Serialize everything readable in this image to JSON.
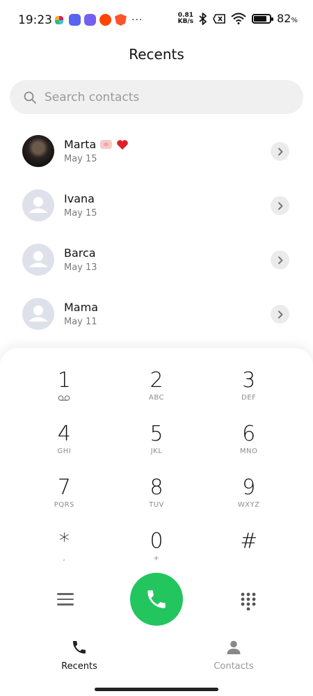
{
  "status_bar": {
    "time": "19:23",
    "net_speed_value": "0.81",
    "net_speed_unit": "KB/s",
    "battery_percent_number": "82",
    "battery_percent_sign": "%",
    "battery_level": 0.82,
    "more_glyph": "···",
    "app_icons": [
      "slack-icon",
      "discord-icon",
      "viber-icon",
      "reddit-icon",
      "brave-icon"
    ]
  },
  "header": {
    "title": "Recents"
  },
  "search": {
    "placeholder": "Search contacts"
  },
  "recents": [
    {
      "name": "Marta",
      "date": "May 15",
      "avatar": "photo",
      "emoji": [
        "pig-icon",
        "heart-icon"
      ]
    },
    {
      "name": "Ivana",
      "date": "May 15",
      "avatar": "default"
    },
    {
      "name": "Barca",
      "date": "May 13",
      "avatar": "default"
    },
    {
      "name": "Mama",
      "date": "May 11",
      "avatar": "default"
    }
  ],
  "dialpad": [
    {
      "digit": "1",
      "letters": ""
    },
    {
      "digit": "2",
      "letters": "ABC"
    },
    {
      "digit": "3",
      "letters": "DEF"
    },
    {
      "digit": "4",
      "letters": "GHI"
    },
    {
      "digit": "5",
      "letters": "JKL"
    },
    {
      "digit": "6",
      "letters": "MNO"
    },
    {
      "digit": "7",
      "letters": "PQRS"
    },
    {
      "digit": "8",
      "letters": "TUV"
    },
    {
      "digit": "9",
      "letters": "WXYZ"
    },
    {
      "digit": "*",
      "letters": ","
    },
    {
      "digit": "0",
      "letters": "+"
    },
    {
      "digit": "#",
      "letters": ""
    }
  ],
  "bottom_nav": {
    "recents_label": "Recents",
    "contacts_label": "Contacts"
  },
  "colors": {
    "call_button": "#22c55e",
    "avatar_bg": "#dfe1ea",
    "search_bg": "#f0f0f0"
  }
}
